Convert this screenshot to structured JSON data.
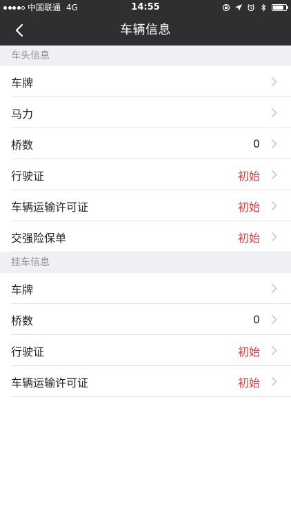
{
  "status_bar": {
    "carrier": "中国联通",
    "network": "4G",
    "time": "14:55",
    "signal_bars": 4,
    "signal_total": 5,
    "battery_level": 0.85
  },
  "nav": {
    "title": "车辆信息",
    "back_icon": "chevron-left-icon"
  },
  "sections": [
    {
      "title": "车头信息",
      "rows": [
        {
          "label": "车牌",
          "value": ""
        },
        {
          "label": "马力",
          "value": ""
        },
        {
          "label": "桥数",
          "value": "0"
        },
        {
          "label": "行驶证",
          "value": "初始"
        },
        {
          "label": "车辆运输许可证",
          "value": "初始"
        },
        {
          "label": "交强险保单",
          "value": "初始"
        }
      ]
    },
    {
      "title": "挂车信息",
      "rows": [
        {
          "label": "车牌",
          "value": ""
        },
        {
          "label": "桥数",
          "value": "0"
        },
        {
          "label": "行驶证",
          "value": "初始"
        },
        {
          "label": "车辆运输许可证",
          "value": "初始"
        }
      ]
    }
  ],
  "colors": {
    "header_bg": "#2f2f31",
    "section_bg": "#efeff4",
    "status_text": "#d0403a",
    "chevron": "#c7c7cc"
  }
}
